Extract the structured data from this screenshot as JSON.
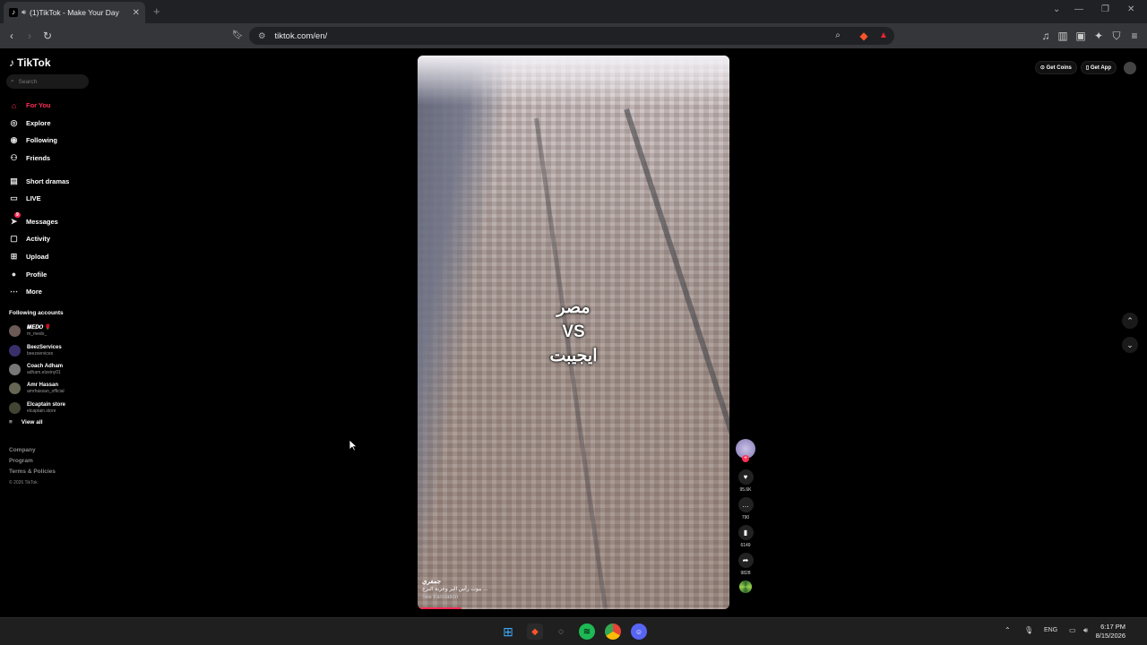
{
  "browser": {
    "tab_title": "(1)TikTok - Make Your Day",
    "new_tab": "+",
    "url": "tiktok.com/en/"
  },
  "tiktok": {
    "logo": "TikTok",
    "search_placeholder": "Search",
    "nav": [
      {
        "label": "For You",
        "icon": "home-icon",
        "active": true
      },
      {
        "label": "Explore",
        "icon": "compass-icon"
      },
      {
        "label": "Following",
        "icon": "following-icon"
      },
      {
        "label": "Friends",
        "icon": "friends-icon"
      },
      {
        "label": "Short dramas",
        "icon": "drama-icon"
      },
      {
        "label": "LIVE",
        "icon": "live-icon"
      },
      {
        "label": "Messages",
        "icon": "messages-icon",
        "badge": "9"
      },
      {
        "label": "Activity",
        "icon": "activity-icon"
      },
      {
        "label": "Upload",
        "icon": "upload-icon"
      },
      {
        "label": "Profile",
        "icon": "profile-icon"
      },
      {
        "label": "More",
        "icon": "more-icon"
      }
    ],
    "following_title": "Following accounts",
    "accounts": [
      {
        "name": "𝑴𝑬𝑫𝑶 🌹",
        "handle": "m_medo_"
      },
      {
        "name": "BeezServices",
        "handle": "beezservices"
      },
      {
        "name": "Coach Adham",
        "handle": "adham.elzeiny01"
      },
      {
        "name": "Amr Hassan",
        "handle": "amrhassan_official"
      },
      {
        "name": "Elcaptain store",
        "handle": "elcaptain.store"
      }
    ],
    "view_all": "View all",
    "footer": {
      "company": "Company",
      "program": "Program",
      "terms": "Terms & Policies",
      "copyright": "© 2026 TikTok"
    },
    "top_buttons": {
      "coins": "Get Coins",
      "app": "Get App"
    }
  },
  "video": {
    "overlay_lines": [
      "مصر",
      "VS",
      "ايجيبت"
    ],
    "author": "جمفري",
    "caption": "بيوت رأس البر وعزبة البرج ...",
    "see_translation": "See translation",
    "progress": 0.14,
    "likes": "95.6K",
    "comments": "790",
    "saves": "6149",
    "shares": "9828"
  },
  "taskbar": {
    "lang": "ENG",
    "time": "6:17 PM",
    "date": "8/15/2026"
  },
  "colors": {
    "accent": "#fe2c55",
    "chrome_bg": "#202124",
    "toolbar_bg": "#35363a"
  }
}
